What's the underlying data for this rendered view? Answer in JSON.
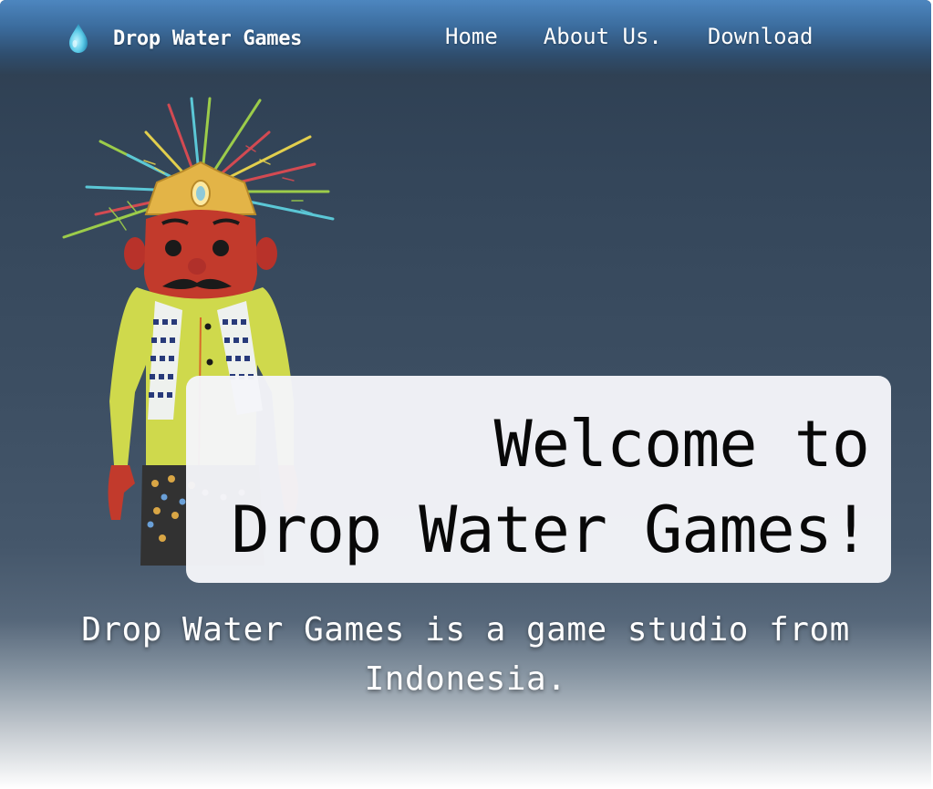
{
  "navbar": {
    "brand_name": "Drop Water Games",
    "brand_icon": "water-drop-icon",
    "links": [
      {
        "label": "Home"
      },
      {
        "label": "About Us."
      },
      {
        "label": "Download"
      }
    ]
  },
  "hero": {
    "welcome_line_1": "Welcome to",
    "welcome_line_2": "Drop Water Games!",
    "tagline": "Drop Water Games is a game studio from Indonesia.",
    "illustration": "ondel-ondel-character"
  },
  "colors": {
    "nav_top": "#4d86bf",
    "background_dark": "#2c3d50",
    "card_bg": "#f4f5f9",
    "character_face": "#c0382b",
    "character_shirt": "#cfd94c"
  }
}
